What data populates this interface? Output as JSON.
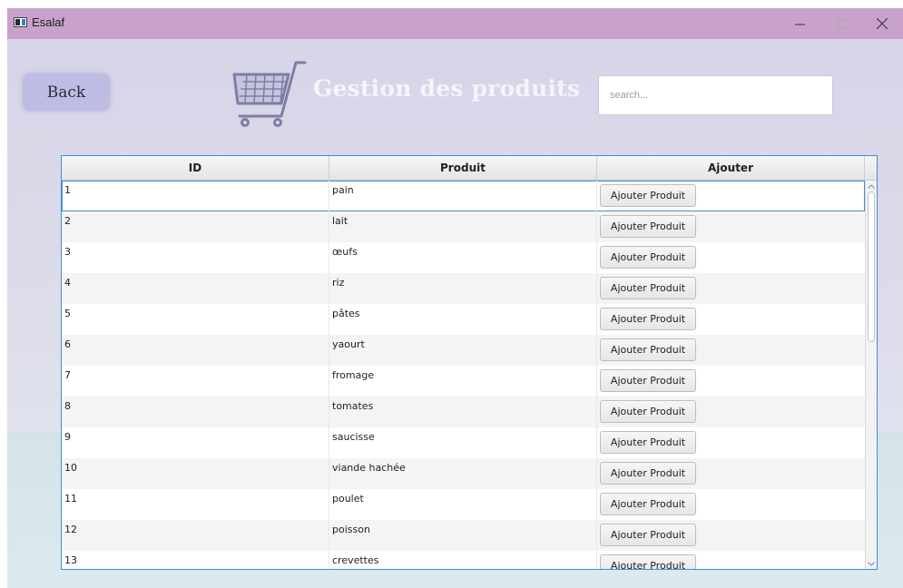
{
  "window": {
    "title": "Esalaf"
  },
  "header": {
    "back_label": "Back",
    "title": "Gestion des produits",
    "search_placeholder": "search..."
  },
  "table": {
    "columns": [
      "ID",
      "Produit",
      "Ajouter"
    ],
    "action_label": "Ajouter Produit",
    "rows": [
      {
        "id": "1",
        "produit": "pain"
      },
      {
        "id": "2",
        "produit": "lait"
      },
      {
        "id": "3",
        "produit": "œufs"
      },
      {
        "id": "4",
        "produit": "riz"
      },
      {
        "id": "5",
        "produit": "pâtes"
      },
      {
        "id": "6",
        "produit": "yaourt"
      },
      {
        "id": "7",
        "produit": "fromage"
      },
      {
        "id": "8",
        "produit": "tomates"
      },
      {
        "id": "9",
        "produit": "saucisse"
      },
      {
        "id": "10",
        "produit": "viande hachée"
      },
      {
        "id": "11",
        "produit": "poulet"
      },
      {
        "id": "12",
        "produit": "poisson"
      },
      {
        "id": "13",
        "produit": "crevettes"
      }
    ],
    "selected_row": 1
  },
  "icons": {
    "app": "app-window-icon",
    "cart": "shopping-cart-icon",
    "minimize": "minimize-icon",
    "maximize": "maximize-icon",
    "close": "close-icon"
  },
  "colors": {
    "titlebar": "#c8a2cc",
    "back_button": "#bdbde3",
    "table_border": "#3d90d9",
    "cart": "#7a7fa6"
  }
}
